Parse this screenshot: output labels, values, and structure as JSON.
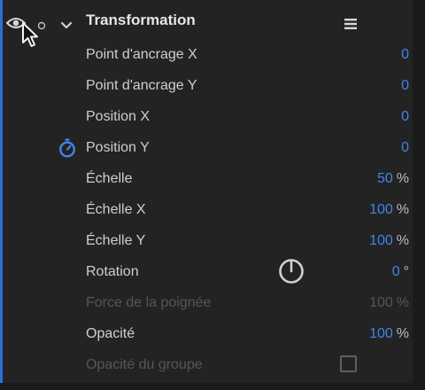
{
  "header": {
    "title": "Transformation"
  },
  "properties": [
    {
      "label": "Point d'ancrage X",
      "value": "0",
      "unit": ""
    },
    {
      "label": "Point d'ancrage Y",
      "value": "0",
      "unit": ""
    },
    {
      "label": "Position X",
      "value": "0",
      "unit": ""
    },
    {
      "label": "Position Y",
      "value": "0",
      "unit": ""
    },
    {
      "label": "Échelle",
      "value": "50",
      "unit": "%"
    },
    {
      "label": "Échelle X",
      "value": "100",
      "unit": "%"
    },
    {
      "label": "Échelle Y",
      "value": "100",
      "unit": "%"
    },
    {
      "label": "Rotation",
      "value": "0",
      "unit": "°"
    },
    {
      "label": "Force de la poignée",
      "value": "100",
      "unit": "%"
    },
    {
      "label": "Opacité",
      "value": "100",
      "unit": "%"
    },
    {
      "label": "Opacité du groupe"
    }
  ],
  "colors": {
    "background": "#232323",
    "accent": "#2a6fd6",
    "value": "#3f86e8",
    "disabled": "#565656"
  },
  "icons": [
    "eye-icon",
    "cursor-icon",
    "circle-icon",
    "chevron-down-icon",
    "menu-icon",
    "stopwatch-icon",
    "rotation-dial-icon"
  ]
}
